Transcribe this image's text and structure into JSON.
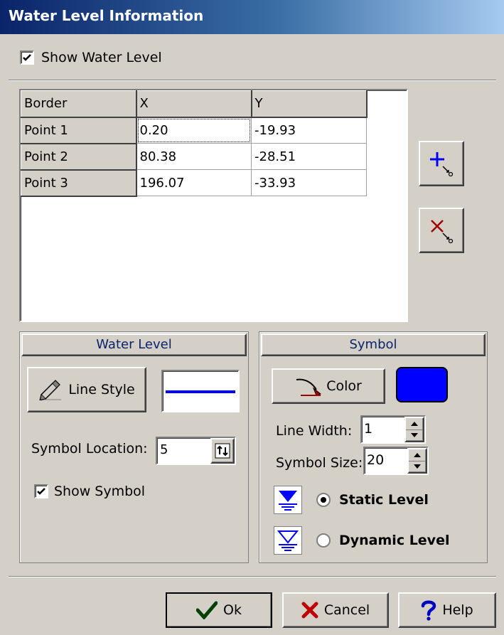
{
  "window": {
    "title": "Water Level Information"
  },
  "show_water_level": {
    "label": "Show Water Level",
    "checked": true
  },
  "grid": {
    "headers": [
      "Border",
      "X",
      "Y"
    ],
    "rows": [
      {
        "label": "Point 1",
        "x": "0.20",
        "y": "-19.93"
      },
      {
        "label": "Point 2",
        "x": "80.38",
        "y": "-28.51"
      },
      {
        "label": "Point 3",
        "x": "196.07",
        "y": "-33.93"
      }
    ],
    "add_point_icon": "add-point-icon",
    "delete_point_icon": "delete-point-icon"
  },
  "water_level": {
    "title": "Water Level",
    "line_style_label": "Line Style",
    "line_color": "#0000ff",
    "symbol_location_label": "Symbol Location:",
    "symbol_location_value": "5",
    "show_symbol_label": "Show Symbol",
    "show_symbol_checked": true
  },
  "symbol": {
    "title": "Symbol",
    "color_label": "Color",
    "color_value": "#0000ff",
    "line_width_label": "Line Width:",
    "line_width_value": "1",
    "symbol_size_label": "Symbol Size:",
    "symbol_size_value": "20",
    "static_level_label": "Static Level",
    "dynamic_level_label": "Dynamic Level",
    "selected": "Static Level"
  },
  "footer": {
    "ok_label": "Ok",
    "cancel_label": "Cancel",
    "help_label": "Help"
  },
  "colors": {
    "title_gradient_start": "#0a246a",
    "dialog_bg": "#d4d0c8",
    "accent_blue": "#0000ff",
    "header_text_blue": "#0a246a"
  }
}
